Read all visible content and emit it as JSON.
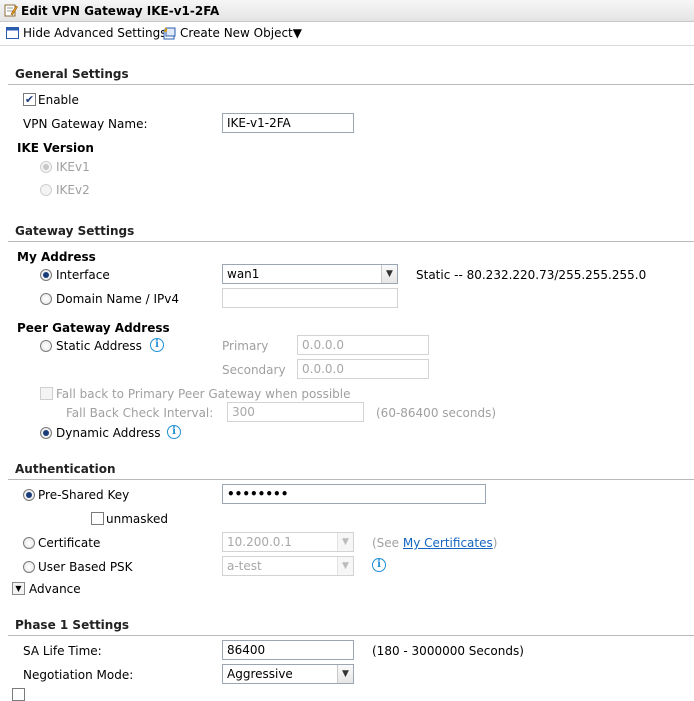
{
  "window": {
    "title": "Edit VPN Gateway IKE-v1-2FA"
  },
  "toolbar": {
    "hide_advanced": "Hide Advanced Settings",
    "create_new": "Create New Object▼"
  },
  "general": {
    "heading": "General Settings",
    "enable_label": "Enable",
    "enable_checked": true,
    "gateway_name_label": "VPN Gateway Name:",
    "gateway_name_value": "IKE-v1-2FA",
    "ike_version_heading": "IKE Version",
    "ike_v1": "IKEv1",
    "ike_v2": "IKEv2",
    "ike_selected": "IKEv1"
  },
  "gateway": {
    "heading": "Gateway Settings",
    "my_address_heading": "My Address",
    "interface_label": "Interface",
    "interface_value": "wan1",
    "interface_status": "Static -- 80.232.220.73/255.255.255.0",
    "domain_label": "Domain Name / IPv4",
    "domain_value": "",
    "peer_heading": "Peer Gateway Address",
    "static_label": "Static Address",
    "primary_label": "Primary",
    "primary_value": "0.0.0.0",
    "secondary_label": "Secondary",
    "secondary_value": "0.0.0.0",
    "fallback_label": "Fall back to Primary Peer Gateway when possible",
    "fallback_interval_label": "Fall Back Check Interval:",
    "fallback_interval_value": "300",
    "fallback_interval_hint": "(60-86400 seconds)",
    "dynamic_label": "Dynamic Address"
  },
  "auth": {
    "heading": "Authentication",
    "psk_label": "Pre-Shared Key",
    "psk_value": "••••••••",
    "unmasked_label": "unmasked",
    "cert_label": "Certificate",
    "cert_value": "10.200.0.1",
    "cert_hint_pre": "(See ",
    "cert_hint_link": "My Certificates",
    "cert_hint_post": ")",
    "user_psk_label": "User Based PSK",
    "user_psk_value": "a-test",
    "advance_label": "Advance"
  },
  "phase1": {
    "heading": "Phase 1 Settings",
    "sa_life_label": "SA Life Time:",
    "sa_life_value": "86400",
    "sa_life_hint": "(180 - 3000000 Seconds)",
    "negotiation_label": "Negotiation Mode:",
    "negotiation_value": "Aggressive"
  },
  "icons": {
    "title": "edit-icon",
    "hide_advanced": "list-icon",
    "create_new": "new-object-icon",
    "info": "info-icon",
    "advance": "expand-triangle-icon"
  },
  "colors": {
    "link": "#1565c0",
    "info": "#1f8fd6",
    "radio_dot": "#1a3d7a"
  }
}
